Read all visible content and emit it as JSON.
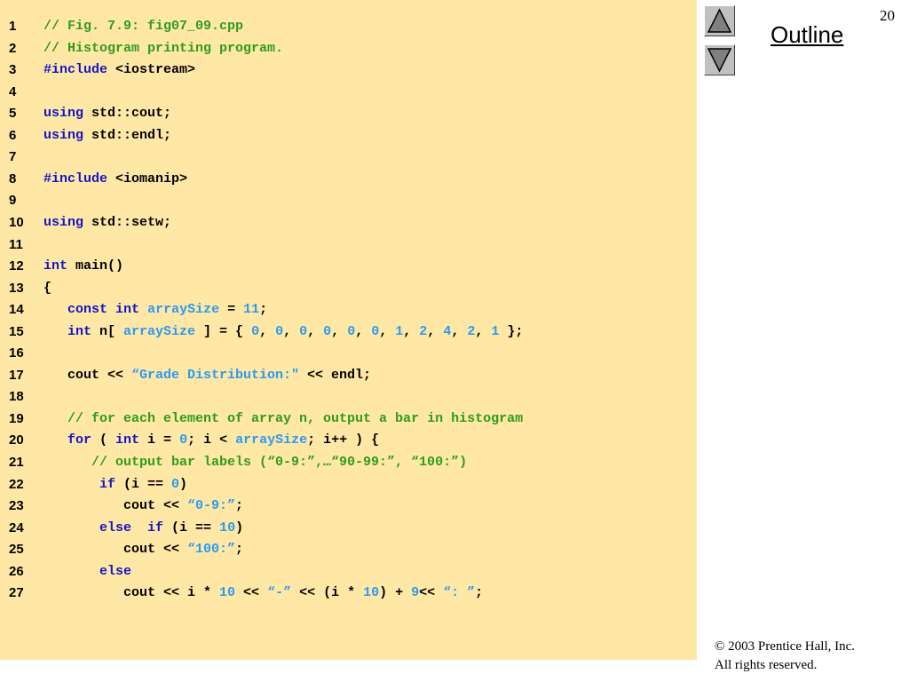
{
  "slide": {
    "number": "20",
    "outline_label": "Outline",
    "copyright_line1": "© 2003 Prentice Hall, Inc.",
    "copyright_line2": "All rights reserved."
  },
  "navigation": {
    "previous_icon": "triangle-up-icon",
    "next_icon": "triangle-down-icon"
  },
  "colors": {
    "code_background": "#ffe7a5",
    "comment": "#2e9c1f",
    "keyword": "#1414c8",
    "literal": "#2a9bf2"
  },
  "code_lines": [
    {
      "n": "1",
      "indent": 0,
      "tokens": [
        [
          "comment",
          "// Fig. 7.9: fig07_09.cpp"
        ]
      ]
    },
    {
      "n": "2",
      "indent": 0,
      "tokens": [
        [
          "comment",
          "// Histogram printing program."
        ]
      ]
    },
    {
      "n": "3",
      "indent": 0,
      "tokens": [
        [
          "keyword",
          "#include"
        ],
        [
          "plain",
          " <iostream>"
        ]
      ]
    },
    {
      "n": "4",
      "indent": 0,
      "tokens": []
    },
    {
      "n": "5",
      "indent": 0,
      "tokens": [
        [
          "keyword",
          "using"
        ],
        [
          "plain",
          " std::cout;"
        ]
      ]
    },
    {
      "n": "6",
      "indent": 0,
      "tokens": [
        [
          "keyword",
          "using"
        ],
        [
          "plain",
          " std::endl;"
        ]
      ]
    },
    {
      "n": "7",
      "indent": 0,
      "tokens": []
    },
    {
      "n": "8",
      "indent": 0,
      "tokens": [
        [
          "keyword",
          "#include"
        ],
        [
          "plain",
          " <iomanip>"
        ]
      ]
    },
    {
      "n": "9",
      "indent": 0,
      "tokens": []
    },
    {
      "n": "10",
      "indent": 0,
      "tokens": [
        [
          "keyword",
          "using"
        ],
        [
          "plain",
          " std::setw;"
        ]
      ]
    },
    {
      "n": "11",
      "indent": 0,
      "tokens": []
    },
    {
      "n": "12",
      "indent": 0,
      "tokens": [
        [
          "keyword",
          "int"
        ],
        [
          "plain",
          " main()"
        ]
      ]
    },
    {
      "n": "13",
      "indent": 0,
      "tokens": [
        [
          "plain",
          "{"
        ]
      ]
    },
    {
      "n": "14",
      "indent": 3,
      "tokens": [
        [
          "keyword",
          "const"
        ],
        [
          "plain",
          " "
        ],
        [
          "keyword",
          "int"
        ],
        [
          "plain",
          " "
        ],
        [
          "identifier",
          "arraySize"
        ],
        [
          "plain",
          " = "
        ],
        [
          "number",
          "11"
        ],
        [
          "plain",
          ";"
        ]
      ]
    },
    {
      "n": "15",
      "indent": 3,
      "tokens": [
        [
          "keyword",
          "int"
        ],
        [
          "plain",
          " n[ "
        ],
        [
          "identifier",
          "arraySize"
        ],
        [
          "plain",
          " ] = { "
        ],
        [
          "number",
          "0"
        ],
        [
          "plain",
          ", "
        ],
        [
          "number",
          "0"
        ],
        [
          "plain",
          ", "
        ],
        [
          "number",
          "0"
        ],
        [
          "plain",
          ", "
        ],
        [
          "number",
          "0"
        ],
        [
          "plain",
          ", "
        ],
        [
          "number",
          "0"
        ],
        [
          "plain",
          ", "
        ],
        [
          "number",
          "0"
        ],
        [
          "plain",
          ", "
        ],
        [
          "number",
          "1"
        ],
        [
          "plain",
          ", "
        ],
        [
          "number",
          "2"
        ],
        [
          "plain",
          ", "
        ],
        [
          "number",
          "4"
        ],
        [
          "plain",
          ", "
        ],
        [
          "number",
          "2"
        ],
        [
          "plain",
          ", "
        ],
        [
          "number",
          "1"
        ],
        [
          "plain",
          " };"
        ]
      ]
    },
    {
      "n": "16",
      "indent": 0,
      "tokens": []
    },
    {
      "n": "17",
      "indent": 3,
      "tokens": [
        [
          "plain",
          "cout << "
        ],
        [
          "string",
          "“Grade Distribution:\""
        ],
        [
          "plain",
          " << endl;"
        ]
      ]
    },
    {
      "n": "18",
      "indent": 0,
      "tokens": []
    },
    {
      "n": "19",
      "indent": 3,
      "tokens": [
        [
          "comment",
          "// for each element of array n, output a bar in histogram"
        ]
      ]
    },
    {
      "n": "20",
      "indent": 3,
      "tokens": [
        [
          "keyword",
          "for"
        ],
        [
          "plain",
          " ( "
        ],
        [
          "keyword",
          "int"
        ],
        [
          "plain",
          " i = "
        ],
        [
          "number",
          "0"
        ],
        [
          "plain",
          "; i < "
        ],
        [
          "identifier",
          "arraySize"
        ],
        [
          "plain",
          "; i++ ) {"
        ]
      ]
    },
    {
      "n": "21",
      "indent": 6,
      "tokens": [
        [
          "comment",
          "// output bar labels (“0-9:”,…“90-99:”, “100:”)"
        ]
      ]
    },
    {
      "n": "22",
      "indent": 7,
      "tokens": [
        [
          "keyword",
          "if"
        ],
        [
          "plain",
          " (i == "
        ],
        [
          "number",
          "0"
        ],
        [
          "plain",
          ")"
        ]
      ]
    },
    {
      "n": "23",
      "indent": 10,
      "tokens": [
        [
          "plain",
          "cout << "
        ],
        [
          "string",
          "“0-9:”"
        ],
        [
          "plain",
          ";"
        ]
      ]
    },
    {
      "n": "24",
      "indent": 7,
      "tokens": [
        [
          "keyword",
          "else"
        ],
        [
          "plain",
          "  "
        ],
        [
          "keyword",
          "if"
        ],
        [
          "plain",
          " (i == "
        ],
        [
          "number",
          "10"
        ],
        [
          "plain",
          ")"
        ]
      ]
    },
    {
      "n": "25",
      "indent": 10,
      "tokens": [
        [
          "plain",
          "cout << "
        ],
        [
          "string",
          "“100:”"
        ],
        [
          "plain",
          ";"
        ]
      ]
    },
    {
      "n": "26",
      "indent": 7,
      "tokens": [
        [
          "keyword",
          "else"
        ]
      ]
    },
    {
      "n": "27",
      "indent": 10,
      "tokens": [
        [
          "plain",
          "cout << i * "
        ],
        [
          "number",
          "10"
        ],
        [
          "plain",
          " << "
        ],
        [
          "string",
          "“-”"
        ],
        [
          "plain",
          " << (i * "
        ],
        [
          "number",
          "10"
        ],
        [
          "plain",
          ") + "
        ],
        [
          "number",
          "9"
        ],
        [
          "plain",
          "<< "
        ],
        [
          "string",
          "“: ”"
        ],
        [
          "plain",
          ";"
        ]
      ]
    }
  ]
}
